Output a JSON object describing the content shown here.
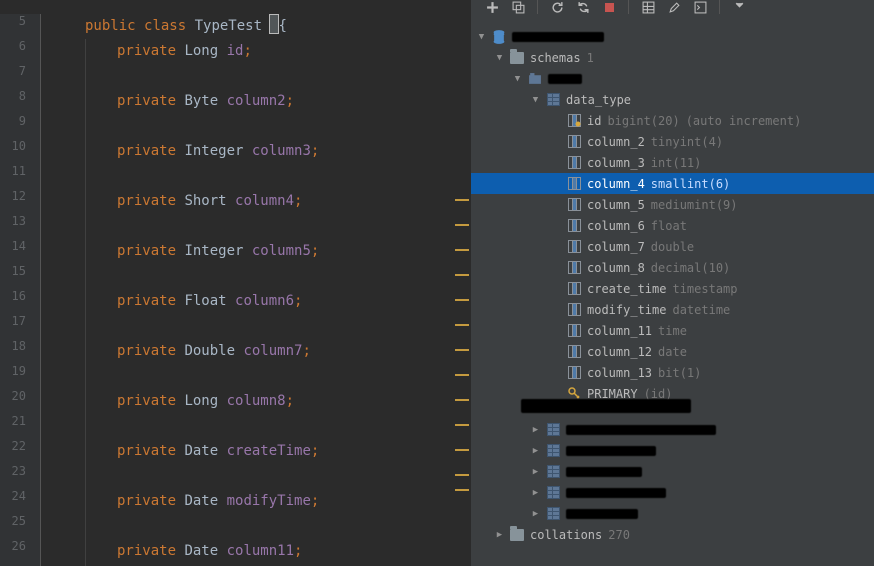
{
  "gutter": {
    "start": 5,
    "end": 26
  },
  "code": {
    "lines": [
      {
        "n": 5,
        "indent": 0,
        "tokens": [
          [
            "kw-mod",
            "public "
          ],
          [
            "kw-mod",
            "class "
          ],
          [
            "type",
            "TypeTest "
          ],
          [
            "cursor",
            "{"
          ]
        ]
      },
      {
        "n": 6,
        "indent": 1,
        "tokens": [
          [
            "kw-mod",
            "private "
          ],
          [
            "type",
            "Long "
          ],
          [
            "field",
            "id"
          ],
          [
            "sc",
            ";"
          ]
        ]
      },
      {
        "n": 7,
        "indent": 0,
        "tokens": []
      },
      {
        "n": 8,
        "indent": 1,
        "tokens": [
          [
            "kw-mod",
            "private "
          ],
          [
            "type",
            "Byte "
          ],
          [
            "field",
            "column2"
          ],
          [
            "sc",
            ";"
          ]
        ]
      },
      {
        "n": 9,
        "indent": 0,
        "tokens": []
      },
      {
        "n": 10,
        "indent": 1,
        "tokens": [
          [
            "kw-mod",
            "private "
          ],
          [
            "type",
            "Integer "
          ],
          [
            "field",
            "column3"
          ],
          [
            "sc",
            ";"
          ]
        ]
      },
      {
        "n": 11,
        "indent": 0,
        "tokens": []
      },
      {
        "n": 12,
        "indent": 1,
        "tokens": [
          [
            "kw-mod",
            "private "
          ],
          [
            "type",
            "Short "
          ],
          [
            "field",
            "column4"
          ],
          [
            "sc",
            ";"
          ]
        ]
      },
      {
        "n": 13,
        "indent": 0,
        "tokens": []
      },
      {
        "n": 14,
        "indent": 1,
        "tokens": [
          [
            "kw-mod",
            "private "
          ],
          [
            "type",
            "Integer "
          ],
          [
            "field",
            "column5"
          ],
          [
            "sc",
            ";"
          ]
        ]
      },
      {
        "n": 15,
        "indent": 0,
        "tokens": []
      },
      {
        "n": 16,
        "indent": 1,
        "tokens": [
          [
            "kw-mod",
            "private "
          ],
          [
            "type",
            "Float "
          ],
          [
            "field",
            "column6"
          ],
          [
            "sc",
            ";"
          ]
        ]
      },
      {
        "n": 17,
        "indent": 0,
        "tokens": []
      },
      {
        "n": 18,
        "indent": 1,
        "tokens": [
          [
            "kw-mod",
            "private "
          ],
          [
            "type",
            "Double "
          ],
          [
            "field",
            "column7"
          ],
          [
            "sc",
            ";"
          ]
        ]
      },
      {
        "n": 19,
        "indent": 0,
        "tokens": []
      },
      {
        "n": 20,
        "indent": 1,
        "tokens": [
          [
            "kw-mod",
            "private "
          ],
          [
            "type",
            "Long "
          ],
          [
            "field",
            "column8"
          ],
          [
            "sc",
            ";"
          ]
        ]
      },
      {
        "n": 21,
        "indent": 0,
        "tokens": []
      },
      {
        "n": 22,
        "indent": 1,
        "tokens": [
          [
            "kw-mod",
            "private "
          ],
          [
            "type",
            "Date "
          ],
          [
            "field",
            "createTime"
          ],
          [
            "sc",
            ";"
          ]
        ]
      },
      {
        "n": 23,
        "indent": 0,
        "tokens": []
      },
      {
        "n": 24,
        "indent": 1,
        "tokens": [
          [
            "kw-mod",
            "private "
          ],
          [
            "type",
            "Date "
          ],
          [
            "field",
            "modifyTime"
          ],
          [
            "sc",
            ";"
          ]
        ]
      },
      {
        "n": 25,
        "indent": 0,
        "tokens": []
      },
      {
        "n": 26,
        "indent": 1,
        "tokens": [
          [
            "kw-mod",
            "private "
          ],
          [
            "type",
            "Date "
          ],
          [
            "field",
            "column11"
          ],
          [
            "sc",
            ";"
          ]
        ]
      }
    ],
    "marks": [
      185,
      210,
      235,
      260,
      285,
      310,
      335,
      360,
      385,
      410,
      435,
      460,
      475
    ]
  },
  "db": {
    "schemas_label": "schemas",
    "schemas_count": "1",
    "table_name": "data_type",
    "columns": [
      {
        "name": "id",
        "type": "bigint(20)",
        "extra": "(auto increment)",
        "pk": true
      },
      {
        "name": "column_2",
        "type": "tinyint(4)"
      },
      {
        "name": "column_3",
        "type": "int(11)"
      },
      {
        "name": "column_4",
        "type": "smallint(6)",
        "selected": true
      },
      {
        "name": "column_5",
        "type": "mediumint(9)"
      },
      {
        "name": "column_6",
        "type": "float"
      },
      {
        "name": "column_7",
        "type": "double"
      },
      {
        "name": "column_8",
        "type": "decimal(10)"
      },
      {
        "name": "create_time",
        "type": "timestamp"
      },
      {
        "name": "modify_time",
        "type": "datetime"
      },
      {
        "name": "column_11",
        "type": "time"
      },
      {
        "name": "column_12",
        "type": "date"
      },
      {
        "name": "column_13",
        "type": "bit(1)"
      }
    ],
    "primary_label": "PRIMARY",
    "primary_cols": "(id)",
    "collations_label": "collations",
    "collations_count": "270"
  }
}
